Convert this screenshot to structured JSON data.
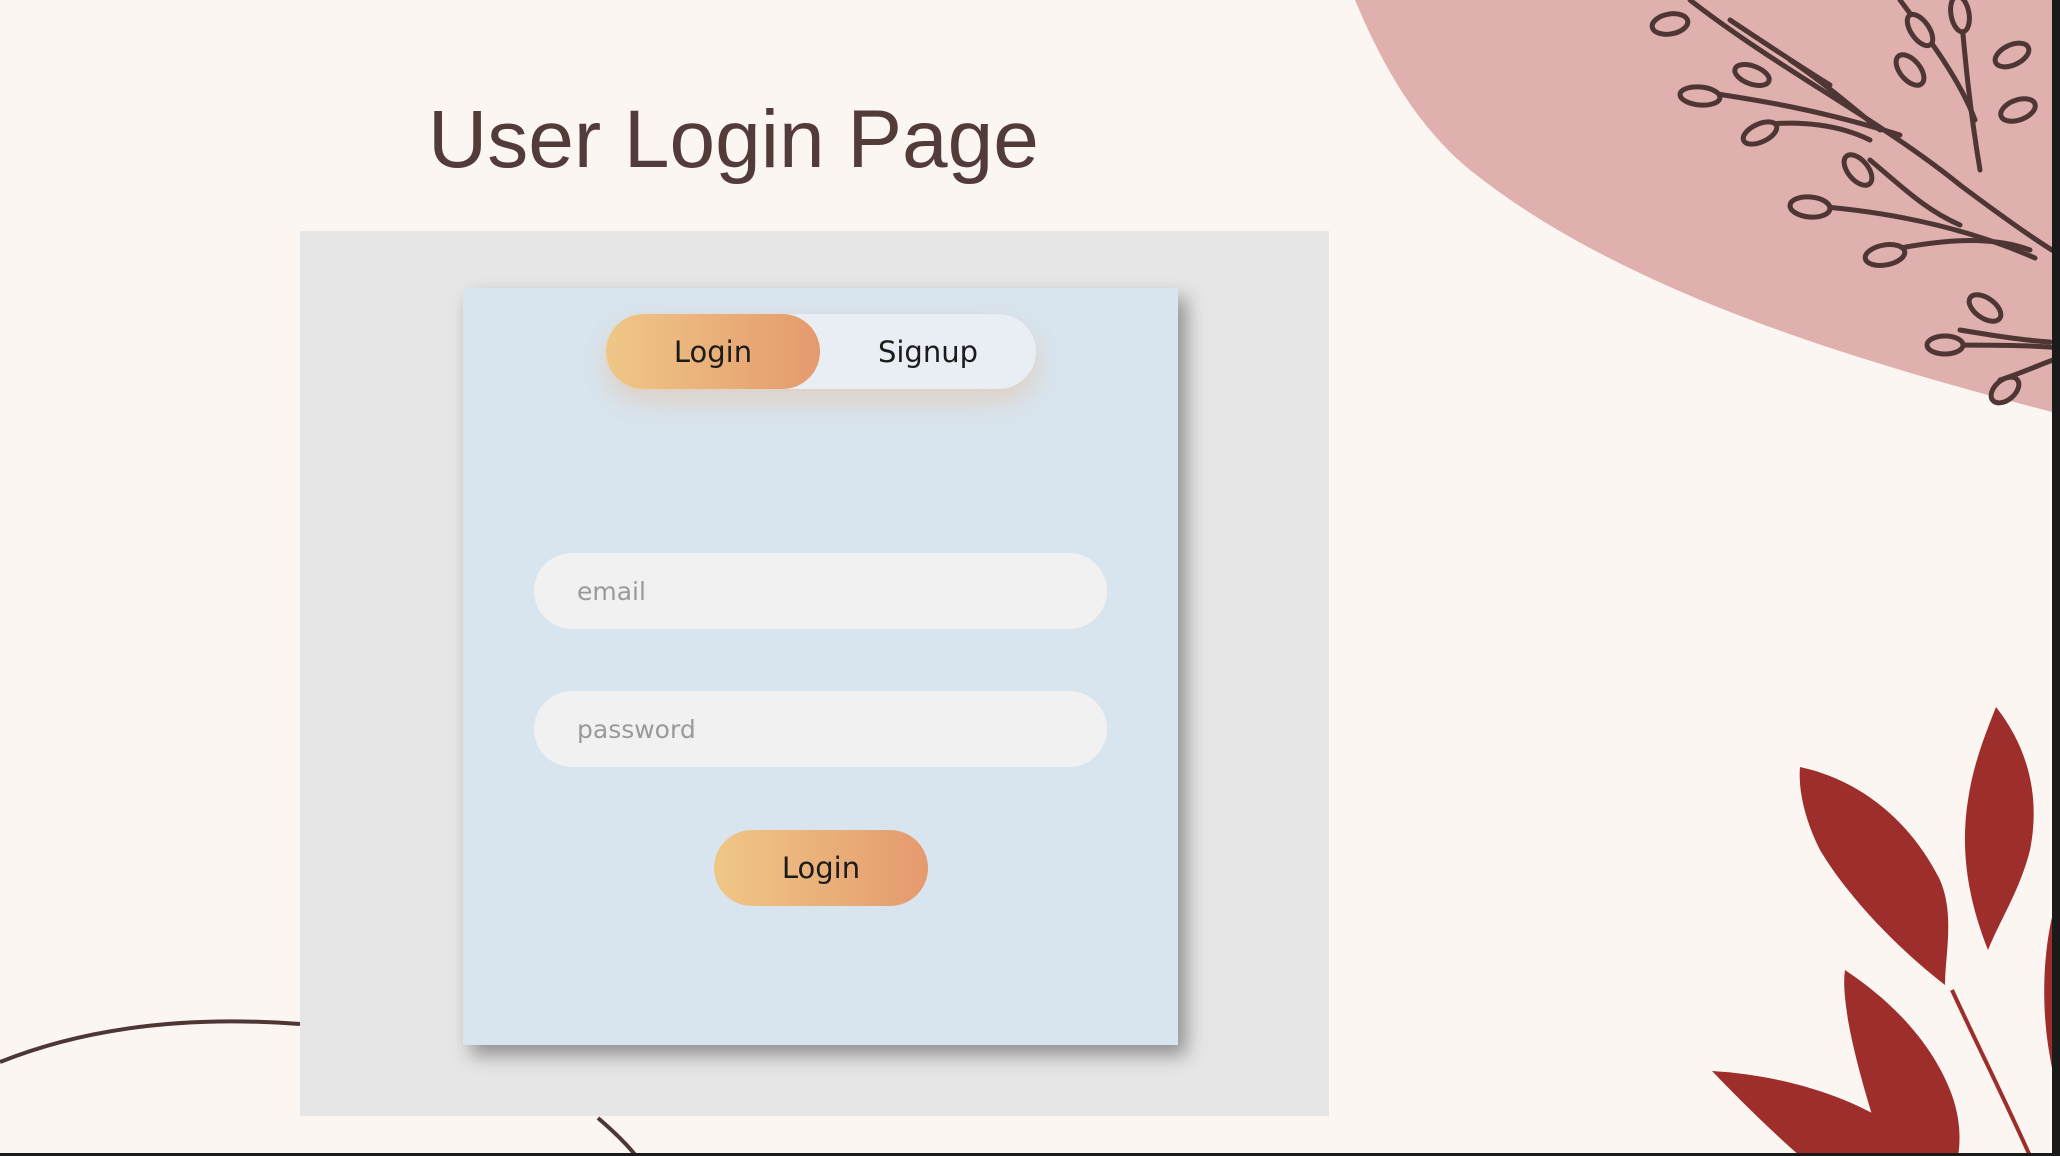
{
  "page": {
    "title": "User Login Page"
  },
  "auth_toggle": {
    "login_label": "Login",
    "signup_label": "Signup",
    "active": "login"
  },
  "login_form": {
    "email_placeholder": "email",
    "email_value": "",
    "password_placeholder": "password",
    "password_value": "",
    "submit_label": "Login"
  },
  "colors": {
    "background": "#fcf6f3",
    "title": "#523b39",
    "frame": "#e6e6e6",
    "card": "#d8e5ef",
    "field": "#f1f1f1",
    "button_gradient_start": "#efc786",
    "button_gradient_end": "#e59a6e",
    "blob": "#dfb0ad",
    "branch": "#4e3634",
    "leaf": "#9e2e2c"
  },
  "decorations": {
    "top_right": "pink-blob-with-branch",
    "bottom_right": "red-leaves",
    "bottom_left": "thin-curved-lines"
  }
}
